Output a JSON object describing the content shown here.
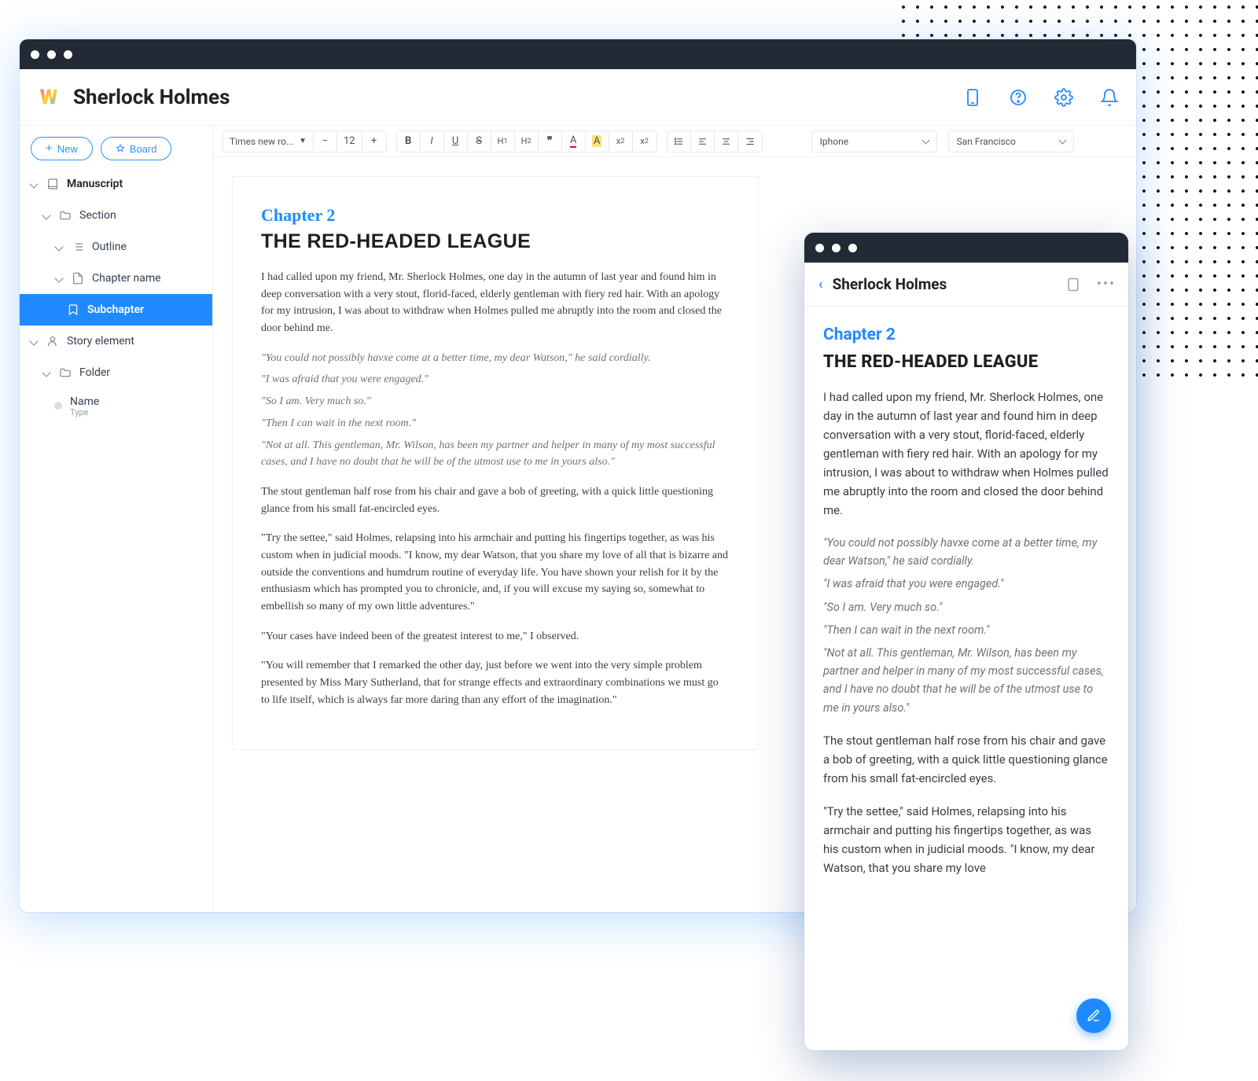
{
  "header": {
    "title": "Sherlock Holmes",
    "logo_text": "W"
  },
  "sidebar": {
    "new_label": "New",
    "board_label": "Board",
    "items": [
      {
        "label": "Manuscript"
      },
      {
        "label": "Section"
      },
      {
        "label": "Outline"
      },
      {
        "label": "Chapter name"
      },
      {
        "label": "Subchapter"
      },
      {
        "label": "Story element"
      },
      {
        "label": "Folder"
      },
      {
        "label": "Name",
        "sub": "Type"
      }
    ]
  },
  "toolbar": {
    "font": "Times new ro...",
    "font_size": "12",
    "device_select": "Iphone",
    "theme_select": "San Francisco"
  },
  "document": {
    "chapter": "Chapter 2",
    "title": "THE RED-HEADED LEAGUE",
    "p1": "I had called upon my friend, Mr. Sherlock Holmes, one day in the autumn of last year and found him in deep conversation with a very stout, florid-faced, elderly gentleman with fiery red hair. With an apology for my intrusion, I was about to withdraw when Holmes pulled me abruptly into the room and closed the door behind me.",
    "q1": "\"You could not possibly havxe come at a better time, my dear Watson,\" he said cordially.",
    "q2": "\"I was afraid that you were engaged.\"",
    "q3": "\"So I am. Very much so.\"",
    "q4": "\"Then I can wait in the next room.\"",
    "q5": "\"Not at all. This gentleman, Mr. Wilson, has been my partner and helper in many of my most successful cases, and I have no doubt that he will be of the utmost use to me in yours also.\"",
    "p2": "The stout gentleman half rose from his chair and gave a bob of greeting, with a quick little questioning glance from his small fat-encircled eyes.",
    "p3": "\"Try the settee,\" said Holmes, relapsing into his armchair and putting his fingertips together, as was his custom when in judicial moods. \"I know, my dear Watson, that you share my love of all that is bizarre and outside the conventions and humdrum routine of everyday life. You have shown your relish for it by the enthusiasm which has prompted you to chronicle, and, if you will excuse my saying so, somewhat to embellish so many of my own little adventures.\"",
    "p4": "\"Your cases have indeed been of the greatest interest to me,\" I observed.",
    "p5": "\"You will remember that I remarked the other day, just before we went into the very simple problem presented by Miss Mary Sutherland, that for strange effects and extraordinary combinations we must go to life itself, which is always far more daring than any effort of the imagination.\""
  },
  "preview": {
    "title": "Sherlock Holmes",
    "p3": "\"Try the settee,\" said Holmes, relapsing into his armchair and putting his fingertips together, as was his custom when in judicial moods. \"I know, my dear Watson, that you share my love"
  }
}
